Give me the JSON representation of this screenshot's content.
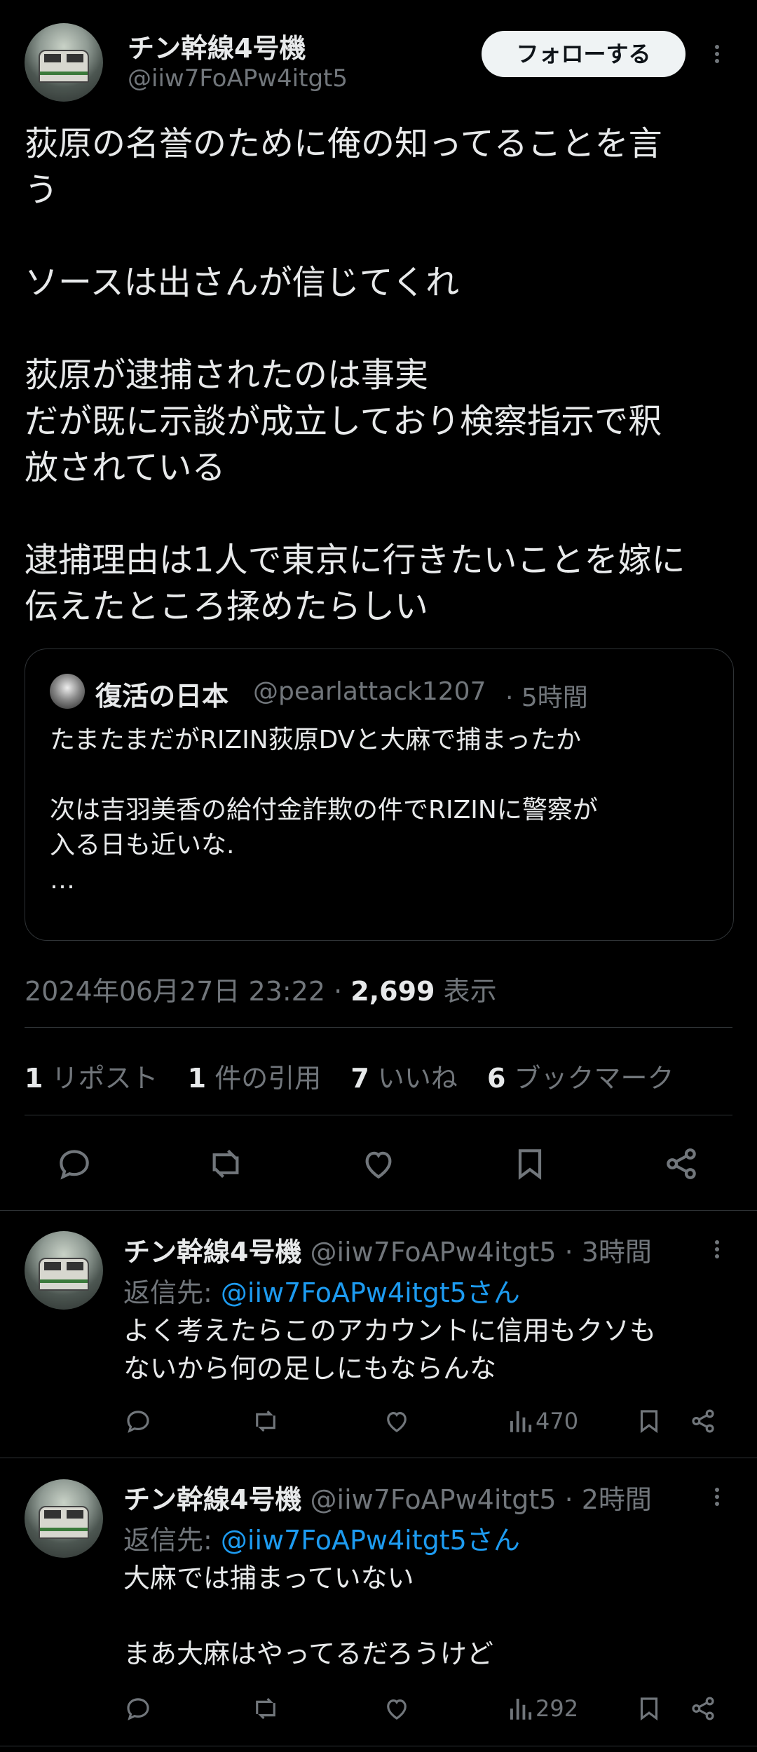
{
  "tweet": {
    "author_name": "チン幹線4号機",
    "author_handle": "@iiw7FoAPw4itgt5",
    "follow_label": "フォローする",
    "text": "荻原の名誉のために俺の知ってることを言\nう\n\nソースは出さんが信じてくれ\n\n荻原が逮捕されたのは事実\nだが既に示談が成立しており検察指示で釈\n放されている\n\n逮捕理由は1人で東京に行きたいことを嫁に\n伝えたところ揉めたらしい",
    "quote": {
      "author_name": "復活の日本",
      "author_handle": "@pearlattack1207",
      "time": "· 5時間",
      "text": "たまたまだがRIZIN荻原DVと大麻で捕まったか\n\n次は吉羽美香の給付金詐欺の件でRIZINに警察が\n入る日も近いな.\n…"
    },
    "timestamp": "2024年06月27日 23:22 ·",
    "views_count": "2,699",
    "views_label": "表示",
    "stats": [
      {
        "count": "1",
        "label": "リポスト"
      },
      {
        "count": "1",
        "label": "件の引用"
      },
      {
        "count": "7",
        "label": "いいね"
      },
      {
        "count": "6",
        "label": "ブックマーク"
      }
    ]
  },
  "replies": [
    {
      "author_name": "チン幹線4号機",
      "author_handle": "@iiw7FoAPw4itgt5",
      "time": "· 3時間",
      "reply_to_prefix": "返信先: ",
      "reply_to_handle": "@iiw7FoAPw4itgt5さん",
      "text": "よく考えたらこのアカウントに信用もクソも\nないから何の足しにもならんな",
      "views": "470"
    },
    {
      "author_name": "チン幹線4号機",
      "author_handle": "@iiw7FoAPw4itgt5",
      "time": "· 2時間",
      "reply_to_prefix": "返信先: ",
      "reply_to_handle": "@iiw7FoAPw4itgt5さん",
      "text": "大麻では捕まっていない\n\nまあ大麻はやってるだろうけど",
      "views": "292"
    }
  ],
  "icons": [
    "reply-icon",
    "retweet-icon",
    "like-icon",
    "bookmark-icon",
    "share-icon",
    "views-icon",
    "more-icon"
  ]
}
